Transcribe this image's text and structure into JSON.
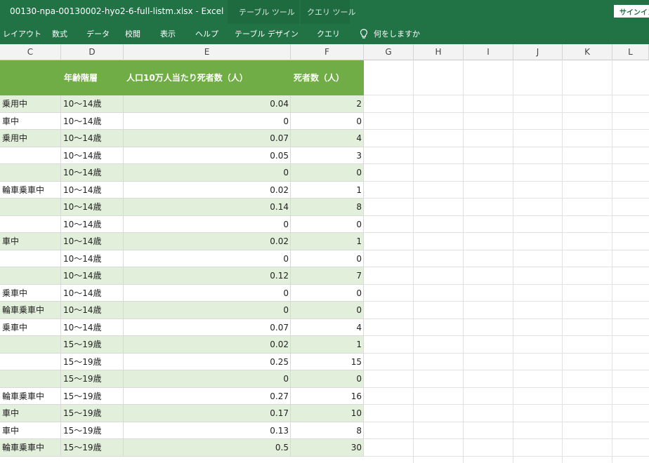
{
  "window": {
    "title": "00130-npa-00130002-hyo2-6-full-listm.xlsx  -  Excel",
    "context_group_table": "テーブル ツール",
    "context_group_query": "クエリ ツール",
    "signin": "サインイン"
  },
  "ribbon": {
    "tabs": [
      "レイアウト",
      "数式",
      "データ",
      "校閲",
      "表示",
      "ヘルプ",
      "テーブル デザイン",
      "クエリ"
    ],
    "tell_me": "何をしますか",
    "tell_me_icon": "lightbulb-icon"
  },
  "columns": [
    "C",
    "D",
    "E",
    "F",
    "G",
    "H",
    "I",
    "J",
    "K",
    "L"
  ],
  "table": {
    "headers": {
      "d": "年齢階層",
      "e": "人口10万人当たり死者数（人）",
      "f": "死者数（人）"
    },
    "rows": [
      {
        "c": "乗用中",
        "d": "10～14歳",
        "e": "0.04",
        "f": "2"
      },
      {
        "c": "車中",
        "d": "10～14歳",
        "e": "0",
        "f": "0"
      },
      {
        "c": "乗用中",
        "d": "10～14歳",
        "e": "0.07",
        "f": "4"
      },
      {
        "c": "",
        "d": "10～14歳",
        "e": "0.05",
        "f": "3"
      },
      {
        "c": "",
        "d": "10～14歳",
        "e": "0",
        "f": "0"
      },
      {
        "c": "輪車乗車中",
        "d": "10～14歳",
        "e": "0.02",
        "f": "1"
      },
      {
        "c": "",
        "d": "10～14歳",
        "e": "0.14",
        "f": "8"
      },
      {
        "c": "",
        "d": "10～14歳",
        "e": "0",
        "f": "0"
      },
      {
        "c": "車中",
        "d": "10～14歳",
        "e": "0.02",
        "f": "1"
      },
      {
        "c": "",
        "d": "10～14歳",
        "e": "0",
        "f": "0"
      },
      {
        "c": "",
        "d": "10～14歳",
        "e": "0.12",
        "f": "7"
      },
      {
        "c": "乗車中",
        "d": "10～14歳",
        "e": "0",
        "f": "0"
      },
      {
        "c": "輪車乗車中",
        "d": "10～14歳",
        "e": "0",
        "f": "0"
      },
      {
        "c": "乗車中",
        "d": "10～14歳",
        "e": "0.07",
        "f": "4"
      },
      {
        "c": "",
        "d": "15～19歳",
        "e": "0.02",
        "f": "1"
      },
      {
        "c": "",
        "d": "15～19歳",
        "e": "0.25",
        "f": "15"
      },
      {
        "c": "",
        "d": "15～19歳",
        "e": "0",
        "f": "0"
      },
      {
        "c": "輪車乗車中",
        "d": "15～19歳",
        "e": "0.27",
        "f": "16"
      },
      {
        "c": "車中",
        "d": "15～19歳",
        "e": "0.17",
        "f": "10"
      },
      {
        "c": "車中",
        "d": "15～19歳",
        "e": "0.13",
        "f": "8"
      },
      {
        "c": "輪車乗車中",
        "d": "15～19歳",
        "e": "0.5",
        "f": "30"
      }
    ]
  },
  "colors": {
    "excel_green": "#217346",
    "table_header": "#70ad47",
    "band": "#e2efda"
  }
}
